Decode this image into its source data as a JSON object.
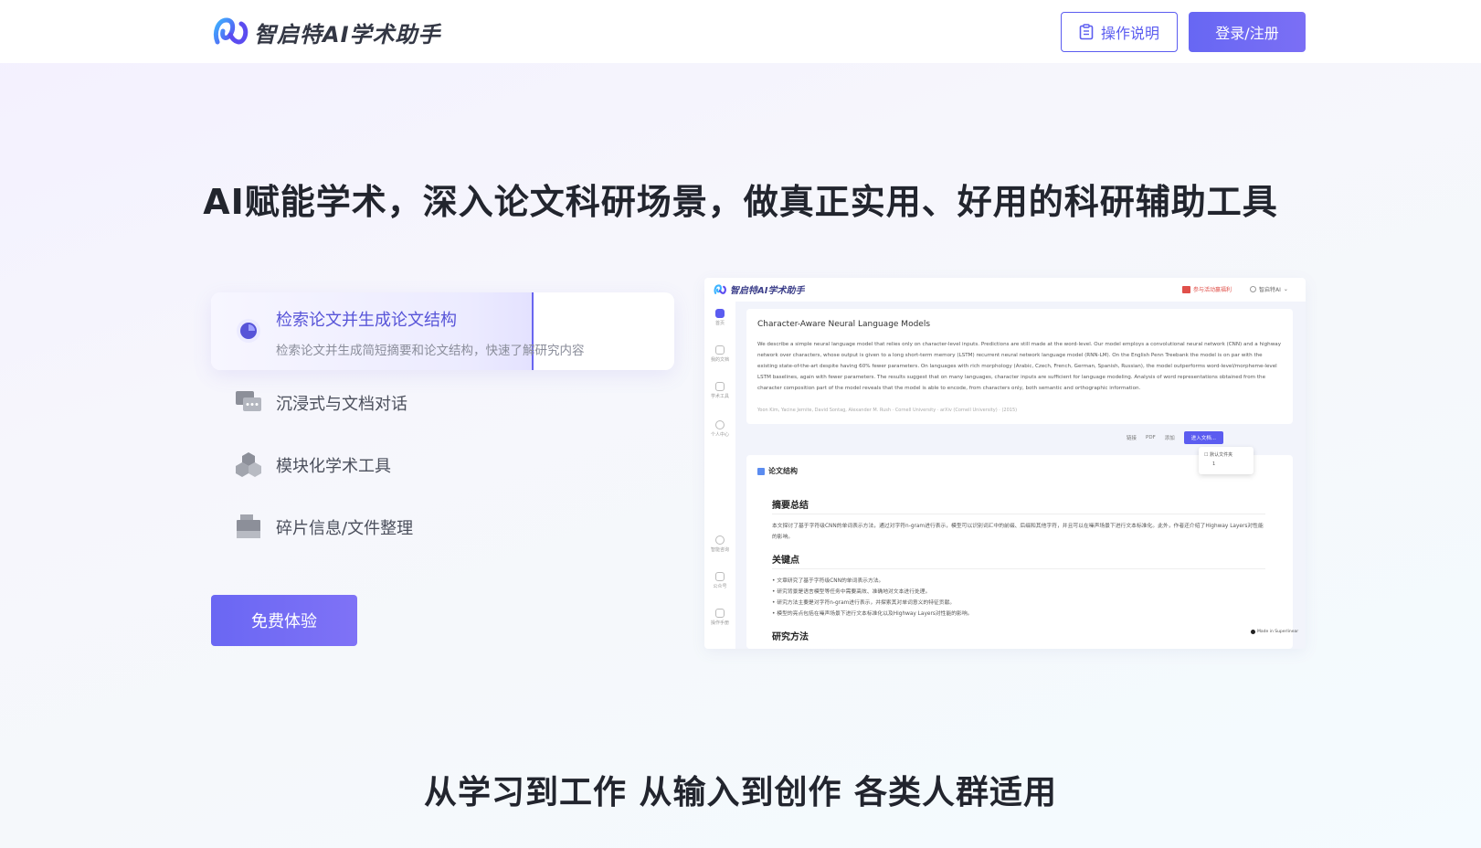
{
  "header": {
    "logo_text": "智启特AI学术助手",
    "guide_button": "操作说明",
    "login_button": "登录/注册",
    "accent_color": "#5b5cf0"
  },
  "hero": {
    "title": "AI赋能学术，深入论文科研场景，做真正实用、好用的科研辅助工具",
    "features": [
      {
        "title": "检索论文并生成论文结构",
        "description": "检索论文并生成简短摘要和论文结构，快速了解研究内容",
        "icon": "search-doc-icon",
        "progress": 0.7
      },
      {
        "title": "沉浸式与文档对话",
        "icon": "chat-bubbles-icon"
      },
      {
        "title": "模块化学术工具",
        "icon": "cubes-icon"
      },
      {
        "title": "碎片信息/文件整理",
        "icon": "file-stack-icon"
      }
    ],
    "trial_button": "免费体验"
  },
  "preview": {
    "logo_text": "智启特AI学术助手",
    "promo_text": "参与活动赢福利",
    "user_text": "智启特AI",
    "side_nav": [
      "首页",
      "我的文档",
      "学术工具",
      "个人中心",
      "智能咨询",
      "公众号",
      "操作手册"
    ],
    "paper_title": "Character-Aware Neural Language Models",
    "abstract": "We describe a simple neural language model that relies only on character-level inputs. Predictions are still made at the word-level. Our model employs a convolutional neural network (CNN) and a highway network over characters, whose output is given to a long short-term memory (LSTM) recurrent neural network language model (RNN-LM). On the English Penn Treebank the model is on par with the existing state-of-the-art despite having 60% fewer parameters. On languages with rich morphology (Arabic, Czech, French, German, Spanish, Russian), the model outperforms word-level/morpheme-level LSTM baselines, again with fewer parameters. The results suggest that on many languages, character inputs are sufficient for language modeling. Analysis of word representations obtained from the character composition part of the model reveals that the model is able to encode, from characters only, both semantic and orthographic information.",
    "authors": "Yoon Kim, Yacine Jernite, David Sontag, Alexander M. Rush · Cornell University · arXiv (Cornell University) · (2015)",
    "actions": {
      "link": "链接",
      "pdf": "PDF",
      "add": "添加",
      "enter": "进入文档..."
    },
    "dropdown": [
      "默认文件夹",
      "1"
    ],
    "structure_title": "论文结构",
    "summary_heading": "摘要总结",
    "summary_text": "本文探讨了基于字符级CNN的单词表示方法，通过对字符n-gram进行表示，模型可以识别词汇中的前缀、后缀和其他字符，并且可以在噪声场景下进行文本标准化。此外，作者还介绍了Highway Layers对性能的影响。",
    "keypoints_heading": "关键点",
    "keypoints": [
      "文章研究了基于字符级CNN的单词表示方法。",
      "研究背景是语言模型等任务中需要高效、准确地对文本进行处理。",
      "研究方法主要是对字符n-gram进行表示，并探索其对单词意义的特征贡献。",
      "模型的亮点包括在噪声场景下进行文本标准化以及Highway Layers对性能的影响。"
    ],
    "methods_heading": "研究方法",
    "made_in": "Made in Superlinear"
  },
  "section2": {
    "title": "从学习到工作 从输入到创作 各类人群适用"
  }
}
